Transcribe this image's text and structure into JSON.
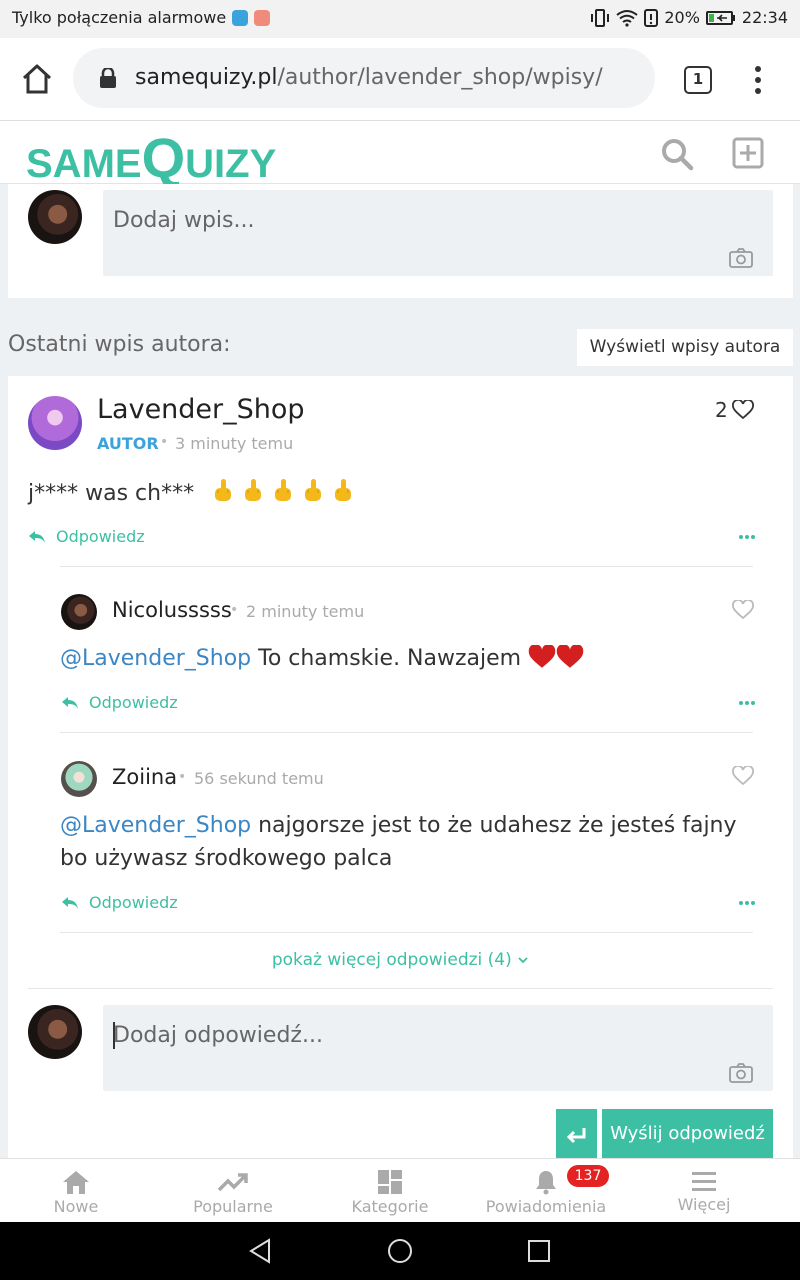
{
  "status_bar": {
    "carrier": "Tylko połączenia alarmowe",
    "battery": "20%",
    "time": "22:34"
  },
  "browser": {
    "url_domain": "samequizy.pl",
    "url_path": "/author/lavender_shop/wpisy/",
    "tab_count": "1"
  },
  "site": {
    "logo_same": "SAME",
    "logo_q": "Q",
    "logo_uizy": "UIZY",
    "brand_color": "#3dbfa4"
  },
  "compose": {
    "placeholder": "Dodaj wpis..."
  },
  "latest": {
    "label": "Ostatni wpis autora:",
    "show_posts_button": "Wyświetl wpisy autora"
  },
  "post": {
    "author": "Lavender_Shop",
    "badge": "AUTOR",
    "time": "3 minuty temu",
    "likes": "2",
    "body": "j**** was ch***",
    "reply_label": "Odpowiedz"
  },
  "comments": [
    {
      "author": "Nicolusssss",
      "time": "2 minuty temu",
      "mention": "@Lavender_Shop",
      "text": " To chamskie. Nawzajem ",
      "reply_label": "Odpowiedz"
    },
    {
      "author": "Zoiina",
      "time": "56 sekund temu",
      "mention": "@Lavender_Shop",
      "text": " najgorsze jest to że udahesz że jesteś fajny bo używasz środkowego palca",
      "reply_label": "Odpowiedz"
    }
  ],
  "show_more": "pokaż więcej odpowiedzi (4)",
  "reply_box": {
    "placeholder": "Dodaj odpowiedź...",
    "send_label": "Wyślij odpowiedź"
  },
  "bottom_nav": {
    "items": [
      {
        "label": "Nowe",
        "icon": "home-icon"
      },
      {
        "label": "Popularne",
        "icon": "trending-icon"
      },
      {
        "label": "Kategorie",
        "icon": "grid-icon"
      },
      {
        "label": "Powiadomienia",
        "icon": "bell-icon"
      },
      {
        "label": "Więcej",
        "icon": "hamburger-icon"
      }
    ],
    "notification_count": "137"
  }
}
